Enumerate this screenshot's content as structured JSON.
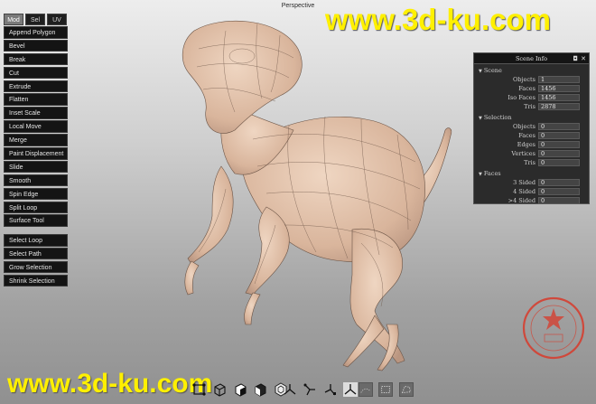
{
  "viewport": {
    "title": "Perspective"
  },
  "mode_tabs": [
    {
      "label": "Mod",
      "active": true
    },
    {
      "label": "Sel",
      "active": false
    },
    {
      "label": "UV",
      "active": false
    }
  ],
  "tools": [
    "Append Polygon",
    "Bevel",
    "Break",
    "Cut",
    "Extrude",
    "Flatten",
    "Inset Scale",
    "Local Move",
    "Merge",
    "Paint Displacement",
    "Slide",
    "Smooth",
    "Spin Edge",
    "Split Loop",
    "Surface Tool"
  ],
  "selection_tools": [
    "Select Loop",
    "Select Path",
    "Grow Selection",
    "Shrink Selection"
  ],
  "scene_info": {
    "title": "Scene Info",
    "min_glyph": "◘",
    "close_glyph": "✕",
    "sections": [
      {
        "name": "Scene",
        "rows": [
          {
            "label": "Objects",
            "value": "1"
          },
          {
            "label": "Faces",
            "value": "1456"
          },
          {
            "label": "Iso Faces",
            "value": "1456"
          },
          {
            "label": "Tris",
            "value": "2878"
          }
        ]
      },
      {
        "name": "Selection",
        "rows": [
          {
            "label": "Objects",
            "value": "0"
          },
          {
            "label": "Faces",
            "value": "0"
          },
          {
            "label": "Edges",
            "value": "0"
          },
          {
            "label": "Vertices",
            "value": "0"
          },
          {
            "label": "Tris",
            "value": "0"
          }
        ]
      },
      {
        "name": "Faces",
        "rows": [
          {
            "label": "3 Sided",
            "value": "0"
          },
          {
            "label": "4 Sided",
            "value": "0"
          },
          {
            "label": ">4 Sided",
            "value": "0"
          }
        ]
      }
    ]
  },
  "watermark": {
    "text": "www.3d-ku.com",
    "color": "#fff000"
  },
  "model": {
    "skin_color": "#e3c3ac",
    "wire_color": "#6b5446"
  },
  "bottom_toolbar": {
    "display_modes": [
      "vertex-display-icon",
      "wireframe-display-icon",
      "flat-shaded-icon",
      "smooth-shaded-icon",
      "cube-icon"
    ],
    "axis_views": [
      "axis-x-view-icon",
      "axis-y-view-icon",
      "axis-z-view-icon",
      "axis-persp-view-icon"
    ],
    "extras": [
      "grid-toggle-icon",
      "select-rect-icon",
      "select-lasso-icon"
    ]
  }
}
